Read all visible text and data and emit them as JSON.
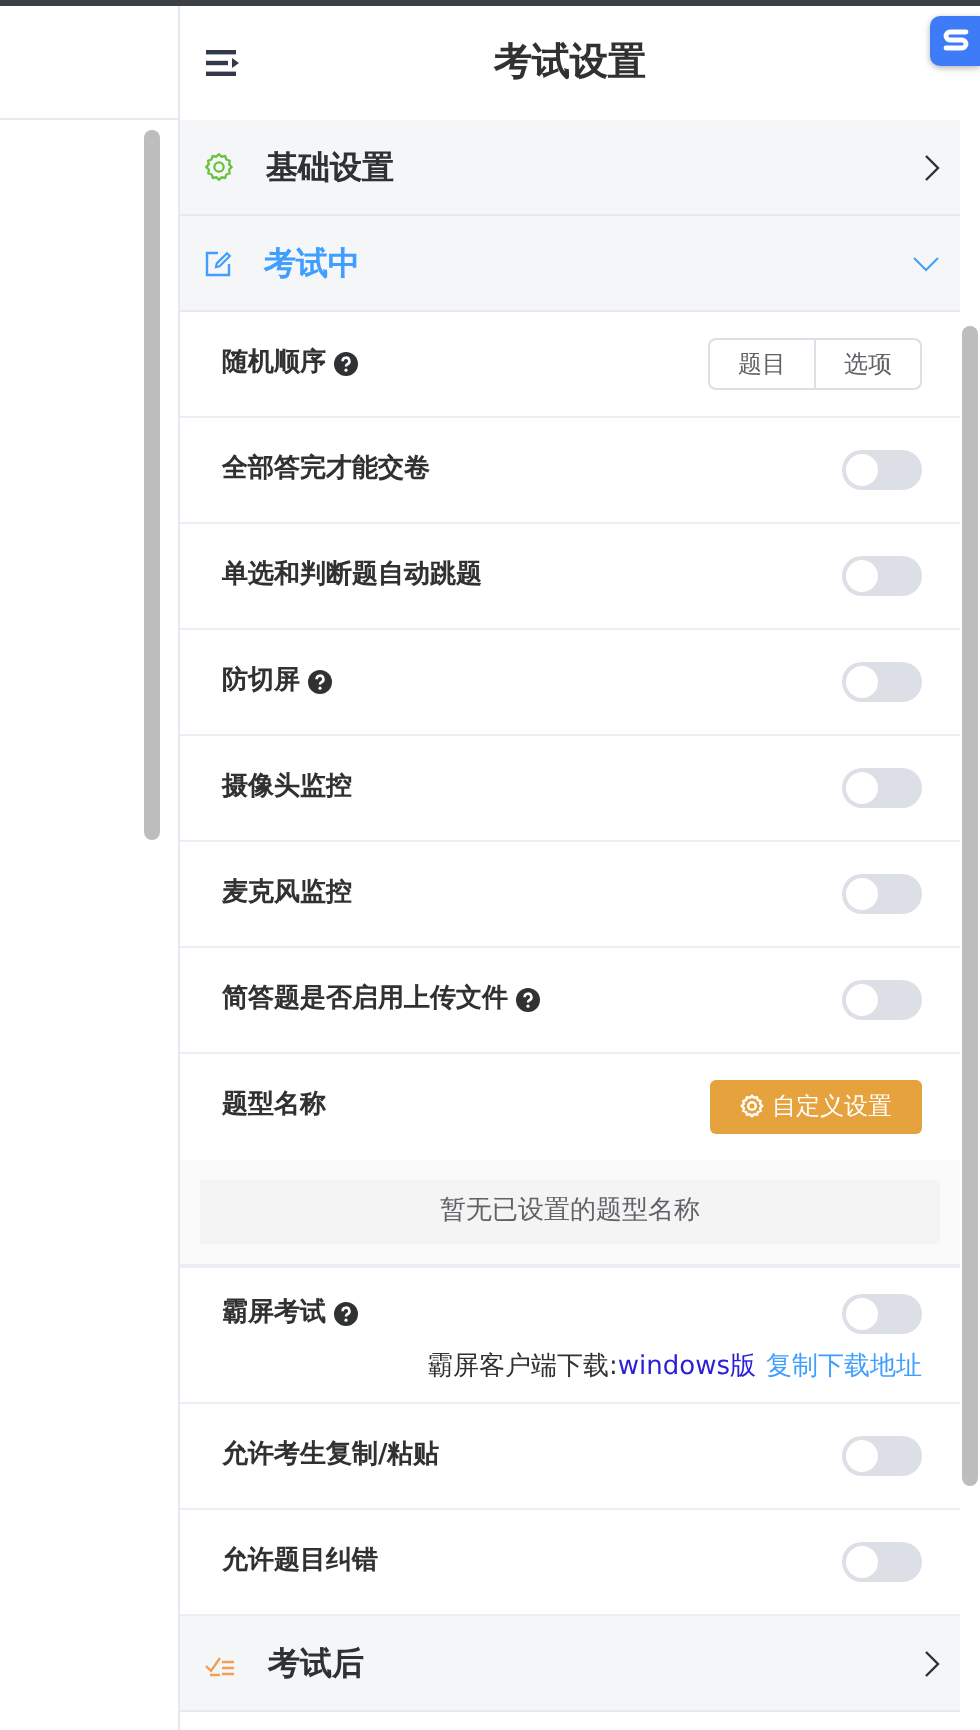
{
  "header": {
    "title": "考试设置"
  },
  "sections": [
    {
      "title": "基础设置",
      "expanded": false
    },
    {
      "title": "考试中",
      "expanded": true,
      "rows": [
        {
          "kind": "segmented",
          "label": "随机顺序",
          "help": true,
          "options": [
            {
              "label": "题目",
              "selected": false
            },
            {
              "label": "选项",
              "selected": false
            }
          ]
        },
        {
          "kind": "toggle",
          "label": "全部答完才能交卷",
          "help": false,
          "on": false
        },
        {
          "kind": "toggle",
          "label": "单选和判断题自动跳题",
          "help": false,
          "on": false
        },
        {
          "kind": "toggle",
          "label": "防切屏",
          "help": true,
          "on": false
        },
        {
          "kind": "toggle",
          "label": "摄像头监控",
          "help": false,
          "on": false
        },
        {
          "kind": "toggle",
          "label": "麦克风监控",
          "help": false,
          "on": false
        },
        {
          "kind": "toggle",
          "label": "简答题是否启用上传文件",
          "help": true,
          "on": false
        },
        {
          "kind": "button",
          "label": "题型名称",
          "help": false,
          "button": "自定义设置",
          "note": "暂无已设置的题型名称"
        },
        {
          "kind": "toggle",
          "label": "霸屏考试",
          "help": true,
          "on": false,
          "download": {
            "text": "霸屏客户端下载:",
            "link": "windows版",
            "copy": "复制下载地址"
          }
        },
        {
          "kind": "toggle",
          "label": "允许考生复制/粘贴",
          "help": false,
          "on": false
        },
        {
          "kind": "toggle",
          "label": "允许题目纠错",
          "help": false,
          "on": false
        }
      ]
    },
    {
      "title": "考试后",
      "expanded": false
    }
  ]
}
